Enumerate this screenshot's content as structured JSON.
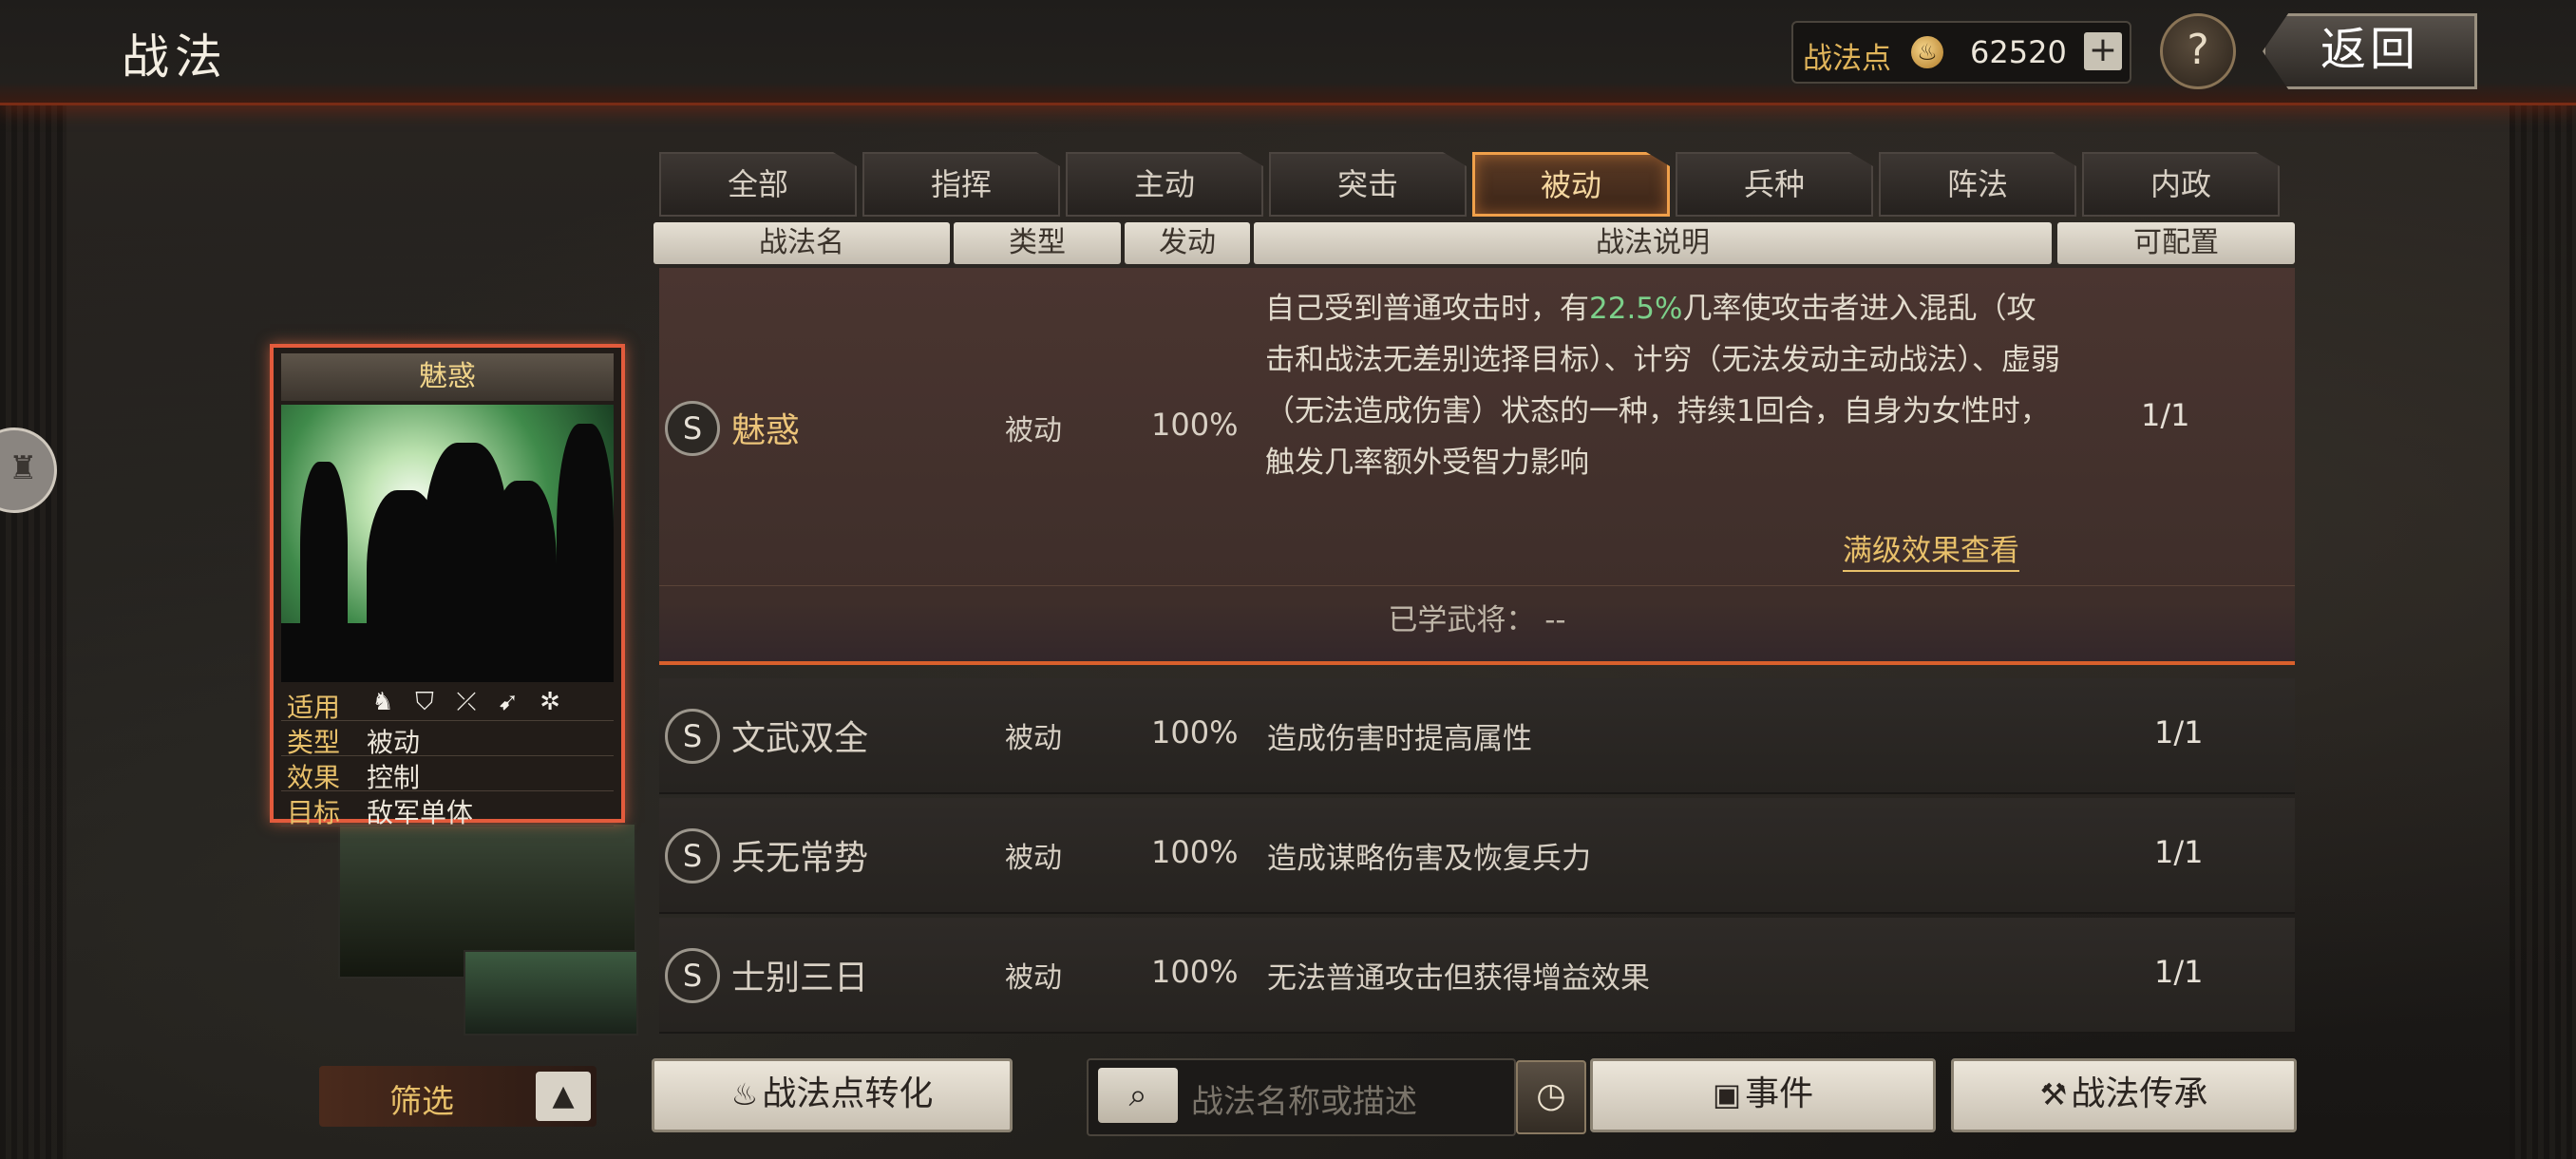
{
  "header": {
    "title": "战法",
    "points_label": "战法点",
    "points_icon": "flame-coin-icon",
    "points_value": "62520",
    "add_label": "+",
    "help_label": "?",
    "back_label": "返回"
  },
  "tabs": [
    {
      "label": "全部",
      "active": false
    },
    {
      "label": "指挥",
      "active": false
    },
    {
      "label": "主动",
      "active": false
    },
    {
      "label": "突击",
      "active": false
    },
    {
      "label": "被动",
      "active": true
    },
    {
      "label": "兵种",
      "active": false
    },
    {
      "label": "阵法",
      "active": false
    },
    {
      "label": "内政",
      "active": false
    }
  ],
  "columns": [
    "战法名",
    "类型",
    "发动",
    "战法说明",
    "可配置"
  ],
  "card": {
    "title": "魅惑",
    "rows": [
      {
        "key": "适用",
        "icons": [
          "cavalry-icon",
          "shield-icon",
          "bow-icon",
          "spear-icon",
          "wheel-icon"
        ]
      },
      {
        "key": "类型",
        "value": "被动"
      },
      {
        "key": "效果",
        "value": "控制"
      },
      {
        "key": "目标",
        "value": "敌军单体"
      }
    ]
  },
  "expanded_row": {
    "badge": "S",
    "name": "魅惑",
    "type": "被动",
    "rate": "100%",
    "desc_pre": "自己受到普通攻击时，有",
    "desc_highlight": "22.5%",
    "desc_post": "几率使攻击者进入混乱（攻击和战法无差别选择目标）、计穷（无法发动主动战法）、虚弱（无法造成伤害）状态的一种，持续1回合，自身为女性时，触发几率额外受智力影响",
    "config": "1/1",
    "full_effect_link": "满级效果查看",
    "learned_label": "已学武将：",
    "learned_value": "--"
  },
  "rows": [
    {
      "badge": "S",
      "name": "文武双全",
      "type": "被动",
      "rate": "100%",
      "desc": "造成伤害时提高属性",
      "config": "1/1"
    },
    {
      "badge": "S",
      "name": "兵无常势",
      "type": "被动",
      "rate": "100%",
      "desc": "造成谋略伤害及恢复兵力",
      "config": "1/1"
    },
    {
      "badge": "S",
      "name": "士别三日",
      "type": "被动",
      "rate": "100%",
      "desc": "无法普通攻击但获得增益效果",
      "config": "1/1"
    }
  ],
  "bottom": {
    "filter_label": "筛选",
    "filter_arrow": "▲",
    "convert_label": "战法点转化",
    "search_placeholder": "战法名称或描述",
    "event_label": "事件",
    "inherit_label": "战法传承"
  }
}
